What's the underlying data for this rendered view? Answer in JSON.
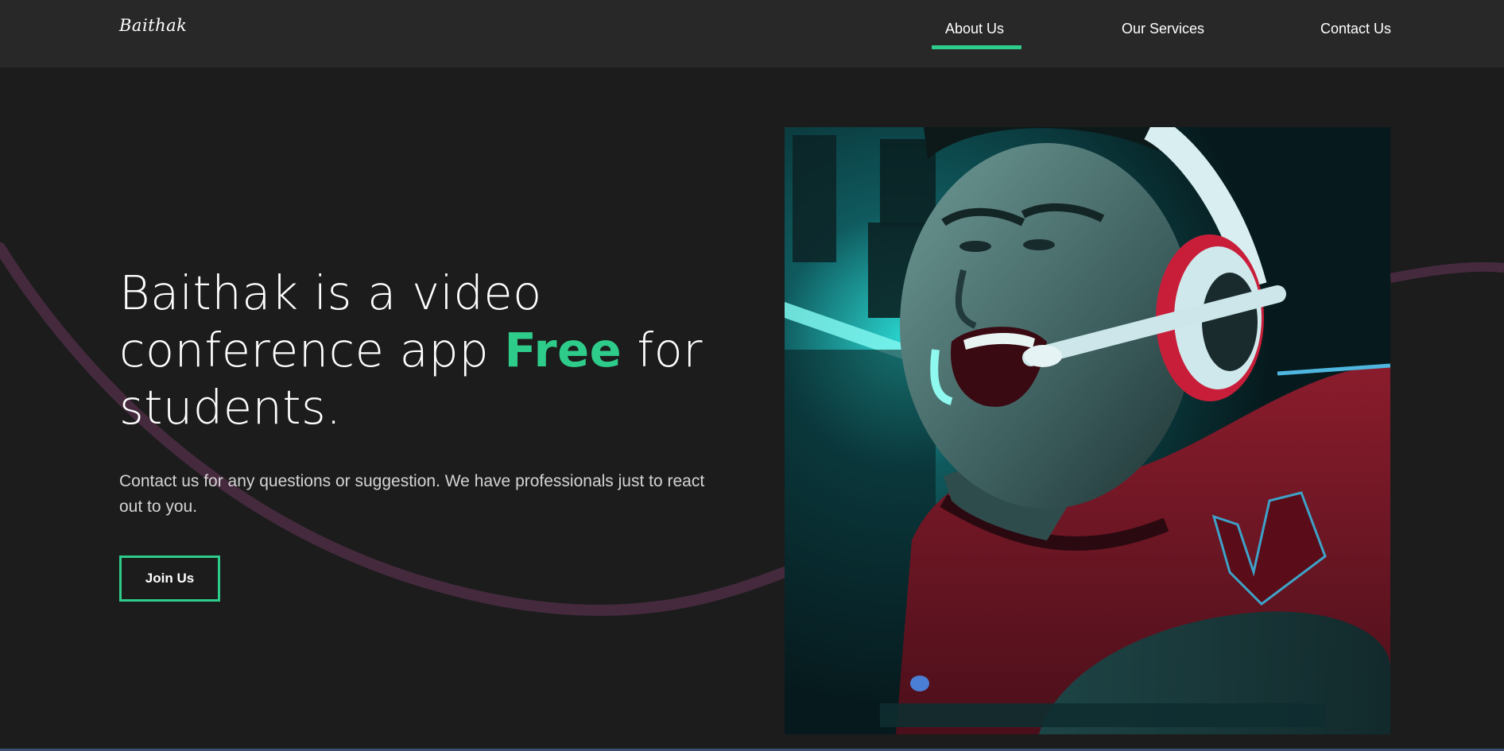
{
  "header": {
    "logo": "Baithak",
    "nav": [
      {
        "label": "About Us",
        "active": true
      },
      {
        "label": "Our Services",
        "active": false
      },
      {
        "label": "Contact Us",
        "active": false
      }
    ]
  },
  "hero": {
    "headline_before": "Baithak is a video conference app ",
    "headline_highlight": "Free",
    "headline_after": " for students.",
    "description": "Contact us for any questions or suggestion. We have professionals just to react out to you.",
    "cta_label": "Join Us",
    "image_alt": "Gamer wearing a headset shouting at the screen"
  },
  "colors": {
    "accent": "#2ecc8a",
    "background": "#1c1c1c",
    "navbar": "#282828",
    "swoosh": "#452a3e"
  }
}
